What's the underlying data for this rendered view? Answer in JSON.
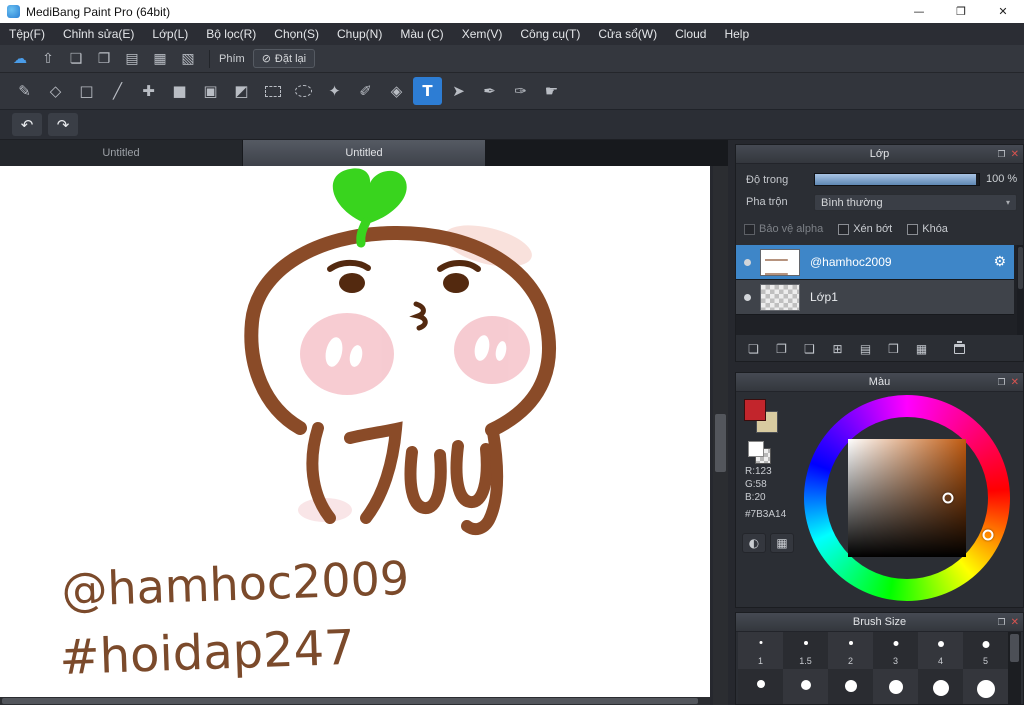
{
  "window": {
    "title": "MediBang Paint Pro (64bit)"
  },
  "icons": {
    "minimize": "—",
    "maximize": "❐",
    "close": "✕",
    "popout": "❐",
    "caret": "▾",
    "gear": "⚙",
    "slash": "⊘",
    "undo": "↶",
    "redo": "↷"
  },
  "menu": {
    "items": [
      "Tệp(F)",
      "Chỉnh sửa(E)",
      "Lớp(L)",
      "Bộ lọc(R)",
      "Chọn(S)",
      "Chụp(N)",
      "Màu (C)",
      "Xem(V)",
      "Công cụ(T)",
      "Cửa sổ(W)",
      "Cloud",
      "Help"
    ]
  },
  "toolbar_top": {
    "icons": [
      {
        "name": "cloud-icon",
        "glyph": "☁",
        "color": "#4a9ce8"
      },
      {
        "name": "publish-icon",
        "glyph": "⇧"
      },
      {
        "name": "comment-icon",
        "glyph": "❏"
      },
      {
        "name": "chat-icon",
        "glyph": "❐"
      },
      {
        "name": "document-icon",
        "glyph": "▤"
      },
      {
        "name": "workspace-icon",
        "glyph": "▦"
      },
      {
        "name": "material-icon",
        "glyph": "▧"
      }
    ],
    "phim_label": "Phím",
    "reset_label": "Đặt lại"
  },
  "tools": [
    {
      "name": "brush-tool",
      "glyph": "✎"
    },
    {
      "name": "eraser-tool",
      "glyph": "◇"
    },
    {
      "name": "shape-brush-tool",
      "glyph": "□"
    },
    {
      "name": "dot-pen-tool",
      "glyph": "╱"
    },
    {
      "name": "move-tool",
      "glyph": "✚"
    },
    {
      "name": "fill-rect-tool",
      "glyph": "■"
    },
    {
      "name": "bucket-tool",
      "glyph": "▣"
    },
    {
      "name": "gradient-tool",
      "glyph": "◩"
    },
    {
      "name": "select-rect-tool",
      "glyph": "",
      "shape": "dashed-rect"
    },
    {
      "name": "lasso-tool",
      "glyph": "",
      "shape": "dashed-ellipse"
    },
    {
      "name": "magic-wand-tool",
      "glyph": "✦"
    },
    {
      "name": "select-pen-tool",
      "glyph": "✐"
    },
    {
      "name": "select-eraser-tool",
      "glyph": "◈"
    },
    {
      "name": "text-tool",
      "glyph": "T",
      "active": true
    },
    {
      "name": "operate-tool",
      "glyph": "➤"
    },
    {
      "name": "eyedropper-tool",
      "glyph": "✒"
    },
    {
      "name": "pen-tool",
      "glyph": "✑"
    },
    {
      "name": "hand-tool",
      "glyph": "☛"
    }
  ],
  "tabs": [
    {
      "label": "Untitled"
    },
    {
      "label": "Untitled",
      "active": true
    }
  ],
  "canvas": {
    "text_line1": "@hamhoc2009",
    "text_line2": "#hoidap247"
  },
  "layer_panel": {
    "title": "Lớp",
    "opacity_label": "Độ trong",
    "opacity_value": "100 %",
    "blend_label": "Pha trộn",
    "blend_value": "Bình thường",
    "checkboxes": [
      {
        "label": "Bảo vệ alpha",
        "disabled": true
      },
      {
        "label": "Xén bớt"
      },
      {
        "label": "Khóa"
      }
    ],
    "layers": [
      {
        "name": "@hamhoc2009",
        "selected": true
      },
      {
        "name": "Lớp1",
        "selected": false
      }
    ],
    "buttons": [
      {
        "name": "new-layer-button",
        "glyph": "❏"
      },
      {
        "name": "new-layer-options-button",
        "glyph": "❐"
      },
      {
        "name": "convert-layer-button",
        "glyph": "❑"
      },
      {
        "name": "import-layer-button",
        "glyph": "⊞"
      },
      {
        "name": "layer-folder-button",
        "glyph": "▤"
      },
      {
        "name": "duplicate-layer-button",
        "glyph": "❒"
      },
      {
        "name": "merge-layer-button",
        "glyph": "▦"
      }
    ]
  },
  "color_panel": {
    "title": "Màu",
    "front_swatch": "#c2252c",
    "back_swatch": "#d8cba0",
    "rgb_lines": [
      "R:123",
      "G:58",
      "B:20"
    ],
    "hex": "#7B3A14",
    "buttons": [
      {
        "name": "palette-button",
        "glyph": "◐"
      },
      {
        "name": "color-tiles-button",
        "glyph": "▦"
      }
    ]
  },
  "brush_panel": {
    "title": "Brush Size",
    "row1": [
      {
        "label": "1",
        "dot": 3
      },
      {
        "label": "1.5",
        "dot": 4
      },
      {
        "label": "2",
        "dot": 4
      },
      {
        "label": "3",
        "dot": 5
      },
      {
        "label": "4",
        "dot": 6
      },
      {
        "label": "5",
        "dot": 7
      }
    ],
    "row2": [
      {
        "dot": 8
      },
      {
        "dot": 10
      },
      {
        "dot": 12
      },
      {
        "dot": 14
      },
      {
        "dot": 16
      },
      {
        "dot": 18
      }
    ]
  }
}
